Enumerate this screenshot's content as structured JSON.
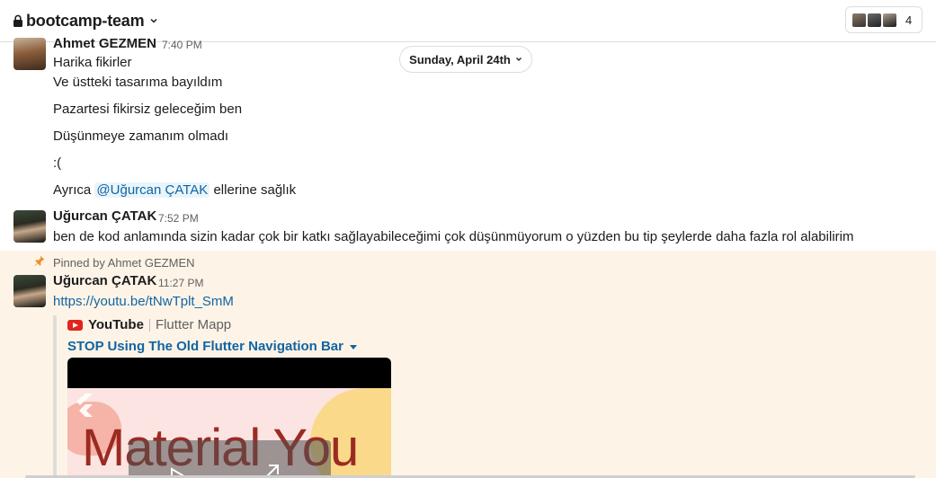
{
  "channel": {
    "name": "bootcamp-team",
    "member_count": "4"
  },
  "date_divider": {
    "label": "Sunday, April 24th"
  },
  "messages": [
    {
      "author": "Ahmet GEZMEN",
      "time": "7:40 PM",
      "lines": [
        "Harika fikirler",
        "Ve üstteki tasarıma bayıldım",
        "Pazartesi fikirsiz geleceğim ben",
        "Düşünmeye zamanım olmadı",
        ":(",
        "Ayrıca"
      ],
      "mention": "@Uğurcan ÇATAK",
      "mention_suffix": "ellerine sağlık"
    },
    {
      "author": "Uğurcan ÇATAK",
      "time": "7:52 PM",
      "text": "ben de kod anlamında sizin kadar çok bir katkı sağlayabileceğimi çok düşünmüyorum o yüzden bu tip şeylerde daha fazla rol alabilirim"
    },
    {
      "pinned_by": "Pinned by Ahmet GEZMEN",
      "author": "Uğurcan ÇATAK",
      "time": "11:27 PM",
      "link": "https://youtu.be/tNwTplt_SmM",
      "unfurl": {
        "service": "YouTube",
        "channel": "Flutter Mapp",
        "title": "STOP Using The Old Flutter Navigation Bar",
        "thumbnail_text": "Material You"
      }
    }
  ],
  "colors": {
    "link": "#1264a3",
    "pinned_background": "#fdf4e7",
    "mention_background": "#e8f5fa"
  }
}
